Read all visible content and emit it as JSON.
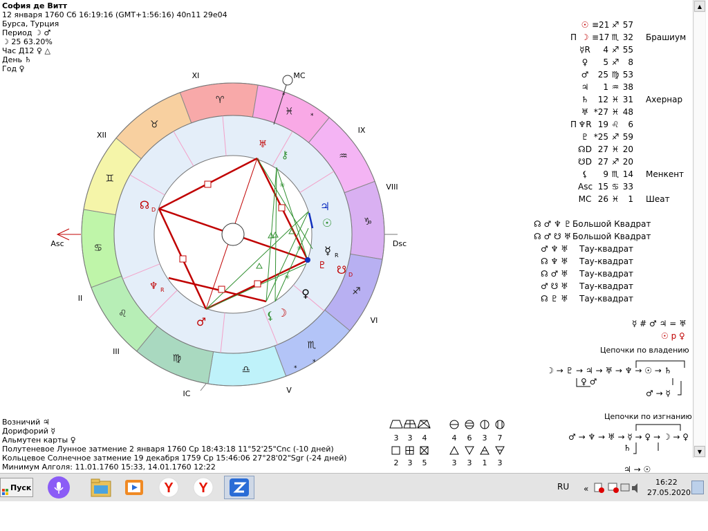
{
  "header": {
    "name": "София де Витт",
    "line2": "12 января 1760  Сб  16:19:16 (GMT+1:56:16) 40n11  29e04",
    "place": "Бурса, Турция",
    "period": "Период ☽ ♂",
    "moon_phase": "☽   25 63.20%",
    "hour": "Час Д12 ♀ △",
    "day": "День ♄",
    "year": "Год ♀"
  },
  "chart": {
    "houses": [
      "XI",
      "IX",
      "XII",
      "VIII",
      "II",
      "VI",
      "III",
      "V",
      "IC"
    ],
    "axis_labels": {
      "asc": "Asc",
      "dsc": "Dsc",
      "mc": "MC",
      "ic": "IC"
    },
    "zodiac_glyphs": [
      "♈",
      "♓",
      "♒",
      "♑",
      "♐",
      "♏",
      "♎",
      "♍",
      "♌",
      "♋",
      "♊",
      "♉"
    ],
    "planet_glyphs": {
      "node": "☊",
      "node_sub": "D",
      "uranus": "♅",
      "chiron": "⚷",
      "jupiter": "♃",
      "sun": "☉",
      "mercury": "☿",
      "mercury_sub": "R",
      "pluto": "♇",
      "southnode": "☋",
      "southnode_sub": "D",
      "venus": "♀",
      "moon": "☽",
      "lilith": "⚸",
      "mars": "♂",
      "neptune": "♆",
      "neptune_sub": "R"
    }
  },
  "positions": [
    {
      "prefix": "",
      "planet": "☉",
      "deg": "≡21",
      "sign": "♐",
      "min": "57",
      "star": ""
    },
    {
      "prefix": "П",
      "planet": "☽",
      "deg": "≡17",
      "sign": "♏",
      "min": "32",
      "star": "Брашиум"
    },
    {
      "prefix": "",
      "planet": "☿R",
      "deg": "4",
      "sign": "♐",
      "min": "55",
      "star": ""
    },
    {
      "prefix": "",
      "planet": "♀",
      "deg": "5",
      "sign": "♐",
      "min": "8",
      "star": ""
    },
    {
      "prefix": "",
      "planet": "♂",
      "deg": "25",
      "sign": "♍",
      "min": "53",
      "star": ""
    },
    {
      "prefix": "",
      "planet": "♃",
      "deg": "1",
      "sign": "♒",
      "min": "38",
      "star": ""
    },
    {
      "prefix": "",
      "planet": "♄",
      "deg": "12",
      "sign": "♓",
      "min": "31",
      "star": "Ахернар"
    },
    {
      "prefix": "",
      "planet": "♅",
      "deg": "*27",
      "sign": "♓",
      "min": "48",
      "star": ""
    },
    {
      "prefix": "П",
      "planet": "♆R",
      "deg": "19",
      "sign": "♌",
      "min": "6",
      "star": ""
    },
    {
      "prefix": "",
      "planet": "♇",
      "deg": "*25",
      "sign": "♐",
      "min": "59",
      "star": ""
    },
    {
      "prefix": "",
      "planet": "☊D",
      "deg": "27",
      "sign": "♓",
      "min": "20",
      "star": ""
    },
    {
      "prefix": "",
      "planet": "☋D",
      "deg": "27",
      "sign": "♐",
      "min": "20",
      "star": ""
    },
    {
      "prefix": "",
      "planet": "⚸",
      "deg": "9",
      "sign": "♏",
      "min": "14",
      "star": "Менкент"
    },
    {
      "prefix": "",
      "planet": "Asc",
      "deg": "15",
      "sign": "♋",
      "min": "33",
      "star": ""
    },
    {
      "prefix": "",
      "planet": "MC",
      "deg": "26",
      "sign": "♓",
      "min": "1",
      "star": "Шеат"
    }
  ],
  "configs": [
    {
      "glyphs": "☊ ♂ ♆ ♇",
      "name": "Большой Квадрат"
    },
    {
      "glyphs": "☊ ♂ ☋ ♅",
      "name": "Большой Квадрат"
    },
    {
      "glyphs": "♂ ♆ ♅",
      "name": "Тау-квадрат"
    },
    {
      "glyphs": "☊ ♆ ♅",
      "name": "Тау-квадрат"
    },
    {
      "glyphs": "☊ ♂ ♅",
      "name": "Тау-квадрат"
    },
    {
      "glyphs": "♂ ☋ ♅",
      "name": "Тау-квадрат"
    },
    {
      "glyphs": "☊ ♇ ♅",
      "name": "Тау-квадрат"
    }
  ],
  "extras": {
    "line1": "☿ # ♂ ♃ = ♅",
    "line2": "☉ р ♀"
  },
  "chains": {
    "own_title": "Цепочки по владению",
    "own_line1": "☽ → ♇ → ♃ → ♅ → ♆ → ☉ → ♄",
    "own_line2": "♀ ♂",
    "own_line3": "♂ → ☿",
    "exile_title": "Цепочки по изгнанию",
    "exile_line1": "♂ → ♆ → ♅ → ☿ → ♀ → ☽ → ♀",
    "exile_line2": "♄",
    "exile_line3": "♃ → ☉"
  },
  "bottom": {
    "line1": "Возничий  ♃",
    "line2": "Дорифорий  ☿",
    "line3": "Альмутен карты  ♀",
    "line4": "Полутеневое Лунное затмение 2 января 1760 Ср 18:43:18 11°52'25\"Cnc (-10 дней)",
    "line5": "Кольцевое Солнечное затмение 19 декабря 1759 Ср 15:46:06 27°28'02\"Sgr (-24 дней)",
    "line6": "Минимум Алголя: 11.01.1760 15:33,  14.01.1760 12:22"
  },
  "aspect_counts": {
    "row1": [
      "3",
      "3",
      "4",
      "4",
      "6",
      "3",
      "7"
    ],
    "row2": [
      "2",
      "3",
      "5",
      "3",
      "3",
      "1",
      "3"
    ]
  },
  "taskbar": {
    "start_label": "Пуск",
    "lang": "RU",
    "time": "16:22",
    "date": "27.05.2020"
  },
  "colors": {
    "red_aspect": "#c00000",
    "green_aspect": "#2f8f2f",
    "zodiac_ring": [
      "#f8a9a9",
      "#f9a9e6",
      "#f4b4f4",
      "#d9b0f2",
      "#b8b0f2",
      "#b3c4f7",
      "#bff2fa",
      "#a9d9c0",
      "#b7eeb6",
      "#bff5a9",
      "#f5f5a9",
      "#f8d0a0"
    ]
  }
}
